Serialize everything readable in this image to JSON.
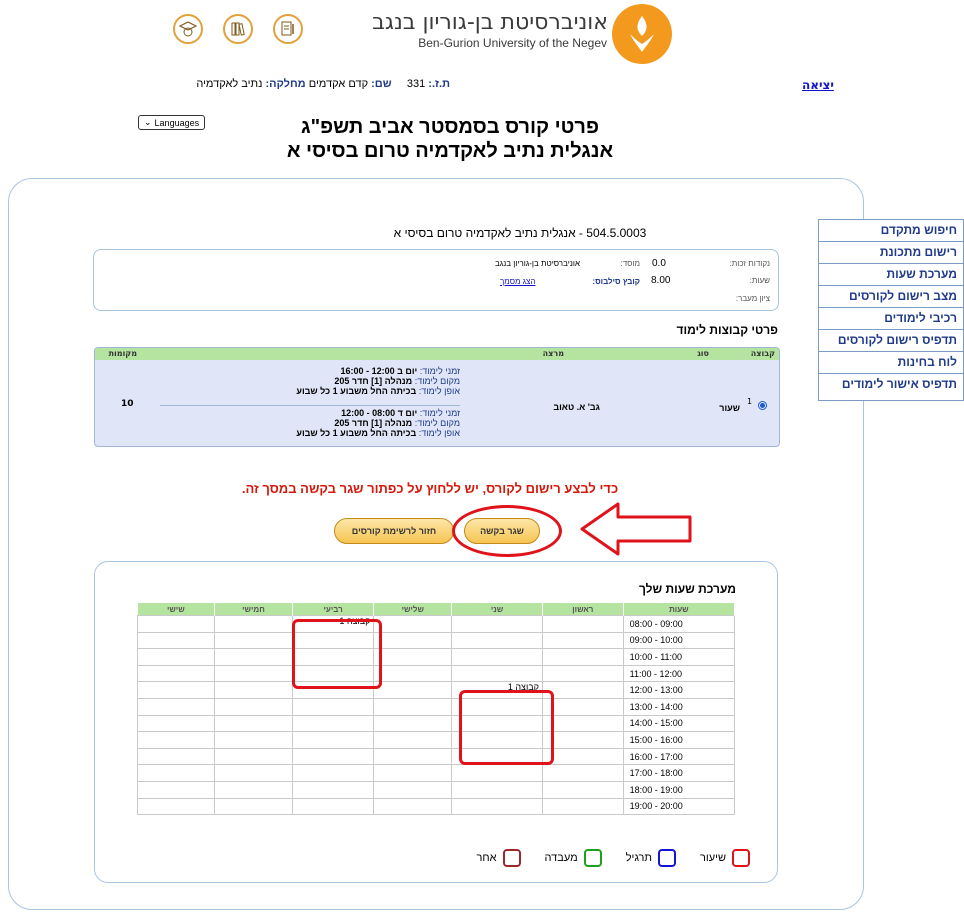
{
  "header": {
    "uni_name_he": "אוניברסיטת בן-גוריון בנגב",
    "uni_name_en": "Ben-Gurion University of the Negev",
    "icons": [
      "graduation-cap-globe-icon",
      "library-books-icon",
      "document-pen-icon"
    ]
  },
  "user": {
    "id_label": "ת.ז.:",
    "id_value": "331",
    "name_label": "שם:",
    "name_value": "קדם אקדמים",
    "dept_label": "מחלקה:",
    "dept_value": "נתיב לאקדמיה",
    "exit_label": "יציאה"
  },
  "languages_label": "Languages",
  "title_line1": "פרטי קורס בסמסטר אביב תשפ\"ג",
  "title_line2": "אנגלית נתיב לאקדמיה טרום בסיסי א",
  "course": {
    "heading": "504.5.0003 - אנגלית נתיב לאקדמיה טרום בסיסי א",
    "credits_label": "נקודות זכות:",
    "credits_value": "0.0",
    "institute_label": "מוסד:",
    "institute_value": "אוניברסיטת בן-גוריון בנגב",
    "hours_label": "שעות:",
    "hours_value": "8.00",
    "syllabus_label": "קובץ סילבוס:",
    "syllabus_link": "הצג מסמך",
    "grade_label": "ציון מעבר:"
  },
  "groups": {
    "title": "פרטי קבוצות לימוד",
    "headers": [
      "קבוצה",
      "סוג",
      "מרצה",
      "מקומות"
    ],
    "row": {
      "group": "1",
      "type": "שעור",
      "lecturer": "גב' א. טאוב",
      "seats": "10",
      "sessions": [
        {
          "time_label": "זמני לימוד:",
          "time_value": "יום ב 12:00 - 16:00",
          "place_label": "מקום לימוד:",
          "place_value": "מנהלה [1] חדר 205",
          "mode_label": "אופן לימוד:",
          "mode_value": "בכיתה החל משבוע 1 כל שבוע"
        },
        {
          "time_label": "זמני לימוד:",
          "time_value": "יום ד 08:00 - 12:00",
          "place_label": "מקום לימוד:",
          "place_value": "מנהלה [1] חדר 205",
          "mode_label": "אופן לימוד:",
          "mode_value": "בכיתה החל משבוע 1 כל שבוע"
        }
      ]
    }
  },
  "warning": "כדי לבצע רישום לקורס, יש ללחוץ על כפתור שגר בקשה במסך זה.",
  "buttons": {
    "submit": "שגר בקשה",
    "back": "חזור לרשימת קורסים"
  },
  "sidebar": {
    "items": [
      "חיפוש מתקדם",
      "רישום מתכונת",
      "מערכת שעות",
      "מצב רישום לקורסים",
      "רכיבי לימודים",
      "תדפיס רישום לקורסים",
      "לוח בחינות",
      "תדפיס אישור לימודים"
    ]
  },
  "schedule": {
    "title": "מערכת שעות שלך",
    "headers": [
      "שעות",
      "ראשון",
      "שני",
      "שלישי",
      "רביעי",
      "חמישי",
      "שישי"
    ],
    "hours": [
      "08:00 - 09:00",
      "09:00 - 10:00",
      "10:00 - 11:00",
      "11:00 - 12:00",
      "12:00 - 13:00",
      "13:00 - 14:00",
      "14:00 - 15:00",
      "15:00 - 16:00",
      "16:00 - 17:00",
      "17:00 - 18:00",
      "18:00 - 19:00",
      "19:00 - 20:00"
    ],
    "cell_label": "קבוצה 1"
  },
  "legend": [
    {
      "label": "שיעור",
      "color": "#e0121a"
    },
    {
      "label": "תרגיל",
      "color": "#1414d8"
    },
    {
      "label": "מעבדה",
      "color": "#1ea01e"
    },
    {
      "label": "אחר",
      "color": "#9b2a2a"
    }
  ],
  "colors": {
    "accent_orange": "#f39a1e",
    "link_blue": "#1212c8",
    "warning_red": "#d4180a",
    "table_header_green": "#b5e3a0",
    "annotation_red": "#e0121a"
  }
}
